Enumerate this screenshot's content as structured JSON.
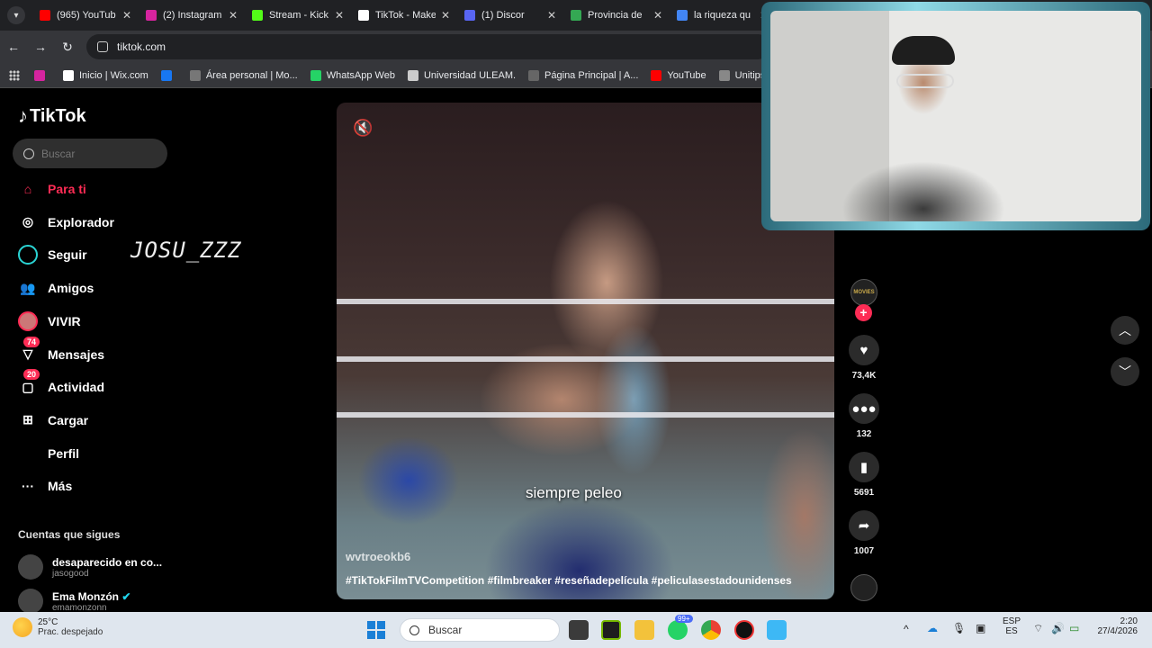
{
  "browser": {
    "tabs": [
      {
        "title": "(965) YouTub",
        "color": "#ff0000"
      },
      {
        "title": "(2) Instagram",
        "color": "#d6249f"
      },
      {
        "title": "Stream - Kick",
        "color": "#53fc18"
      },
      {
        "title": "TikTok - Make",
        "color": "#ffffff"
      },
      {
        "title": "(1) Discor",
        "color": "#5865f2"
      },
      {
        "title": "Provincia de",
        "color": "#34a853"
      },
      {
        "title": "la riqueza qu",
        "color": "#4285f4"
      }
    ],
    "url": "tiktok.com",
    "bookmarks": [
      {
        "label": "",
        "color": "#d6249f"
      },
      {
        "label": "Inicio | Wix.com",
        "color": "#ffffff"
      },
      {
        "label": "",
        "color": "#1877f2"
      },
      {
        "label": "Área personal | Mo...",
        "color": "#777777"
      },
      {
        "label": "WhatsApp Web",
        "color": "#25d366"
      },
      {
        "label": "Universidad ULEAM.",
        "color": "#cccccc"
      },
      {
        "label": "Página Principal | A...",
        "color": "#666666"
      },
      {
        "label": "YouTube",
        "color": "#ff0000"
      },
      {
        "label": "Unitips | Cursos pa",
        "color": "#888888"
      }
    ]
  },
  "tiktok": {
    "logo": "TikTok",
    "search_placeholder": "Buscar",
    "nav": [
      {
        "label": "Para ti",
        "icon": "home-icon",
        "active": true
      },
      {
        "label": "Explorador",
        "icon": "compass-icon"
      },
      {
        "label": "Seguir",
        "icon": "following-icon"
      },
      {
        "label": "Amigos",
        "icon": "friends-icon"
      },
      {
        "label": "VIVIR",
        "icon": "live-icon"
      },
      {
        "label": "Mensajes",
        "icon": "messages-icon",
        "badge": "74"
      },
      {
        "label": "Actividad",
        "icon": "activity-icon",
        "badge": "20"
      },
      {
        "label": "Cargar",
        "icon": "upload-icon"
      },
      {
        "label": "Perfil",
        "icon": "profile-icon"
      },
      {
        "label": "Más",
        "icon": "more-icon"
      }
    ],
    "following_title": "Cuentas que sigues",
    "following": [
      {
        "name": "desaparecido en co...",
        "handle": "jasogood"
      },
      {
        "name": "Ema Monzón",
        "handle": "emamonzonn",
        "verified": true
      }
    ],
    "handwritten_overlay": "JOSU_ZZZ",
    "video": {
      "caption": "siempre peleo",
      "author": "wvtroeokb6",
      "hashtags": "#TikTokFilmTVCompetition #filmbreaker #reseñadepelícula #peliculasestadounidenses",
      "likes": "73,4K",
      "comments": "132",
      "saves": "5691",
      "shares": "1007",
      "creator_avatar_text": "MOVIES"
    }
  },
  "taskbar": {
    "temperature": "25°C",
    "weather": "Prac. despejado",
    "search_placeholder": "Buscar",
    "whatsapp_badge": "99+",
    "language_top": "ESP",
    "language_bottom": "ES",
    "time": "2:20",
    "date": "27/4/2026"
  }
}
